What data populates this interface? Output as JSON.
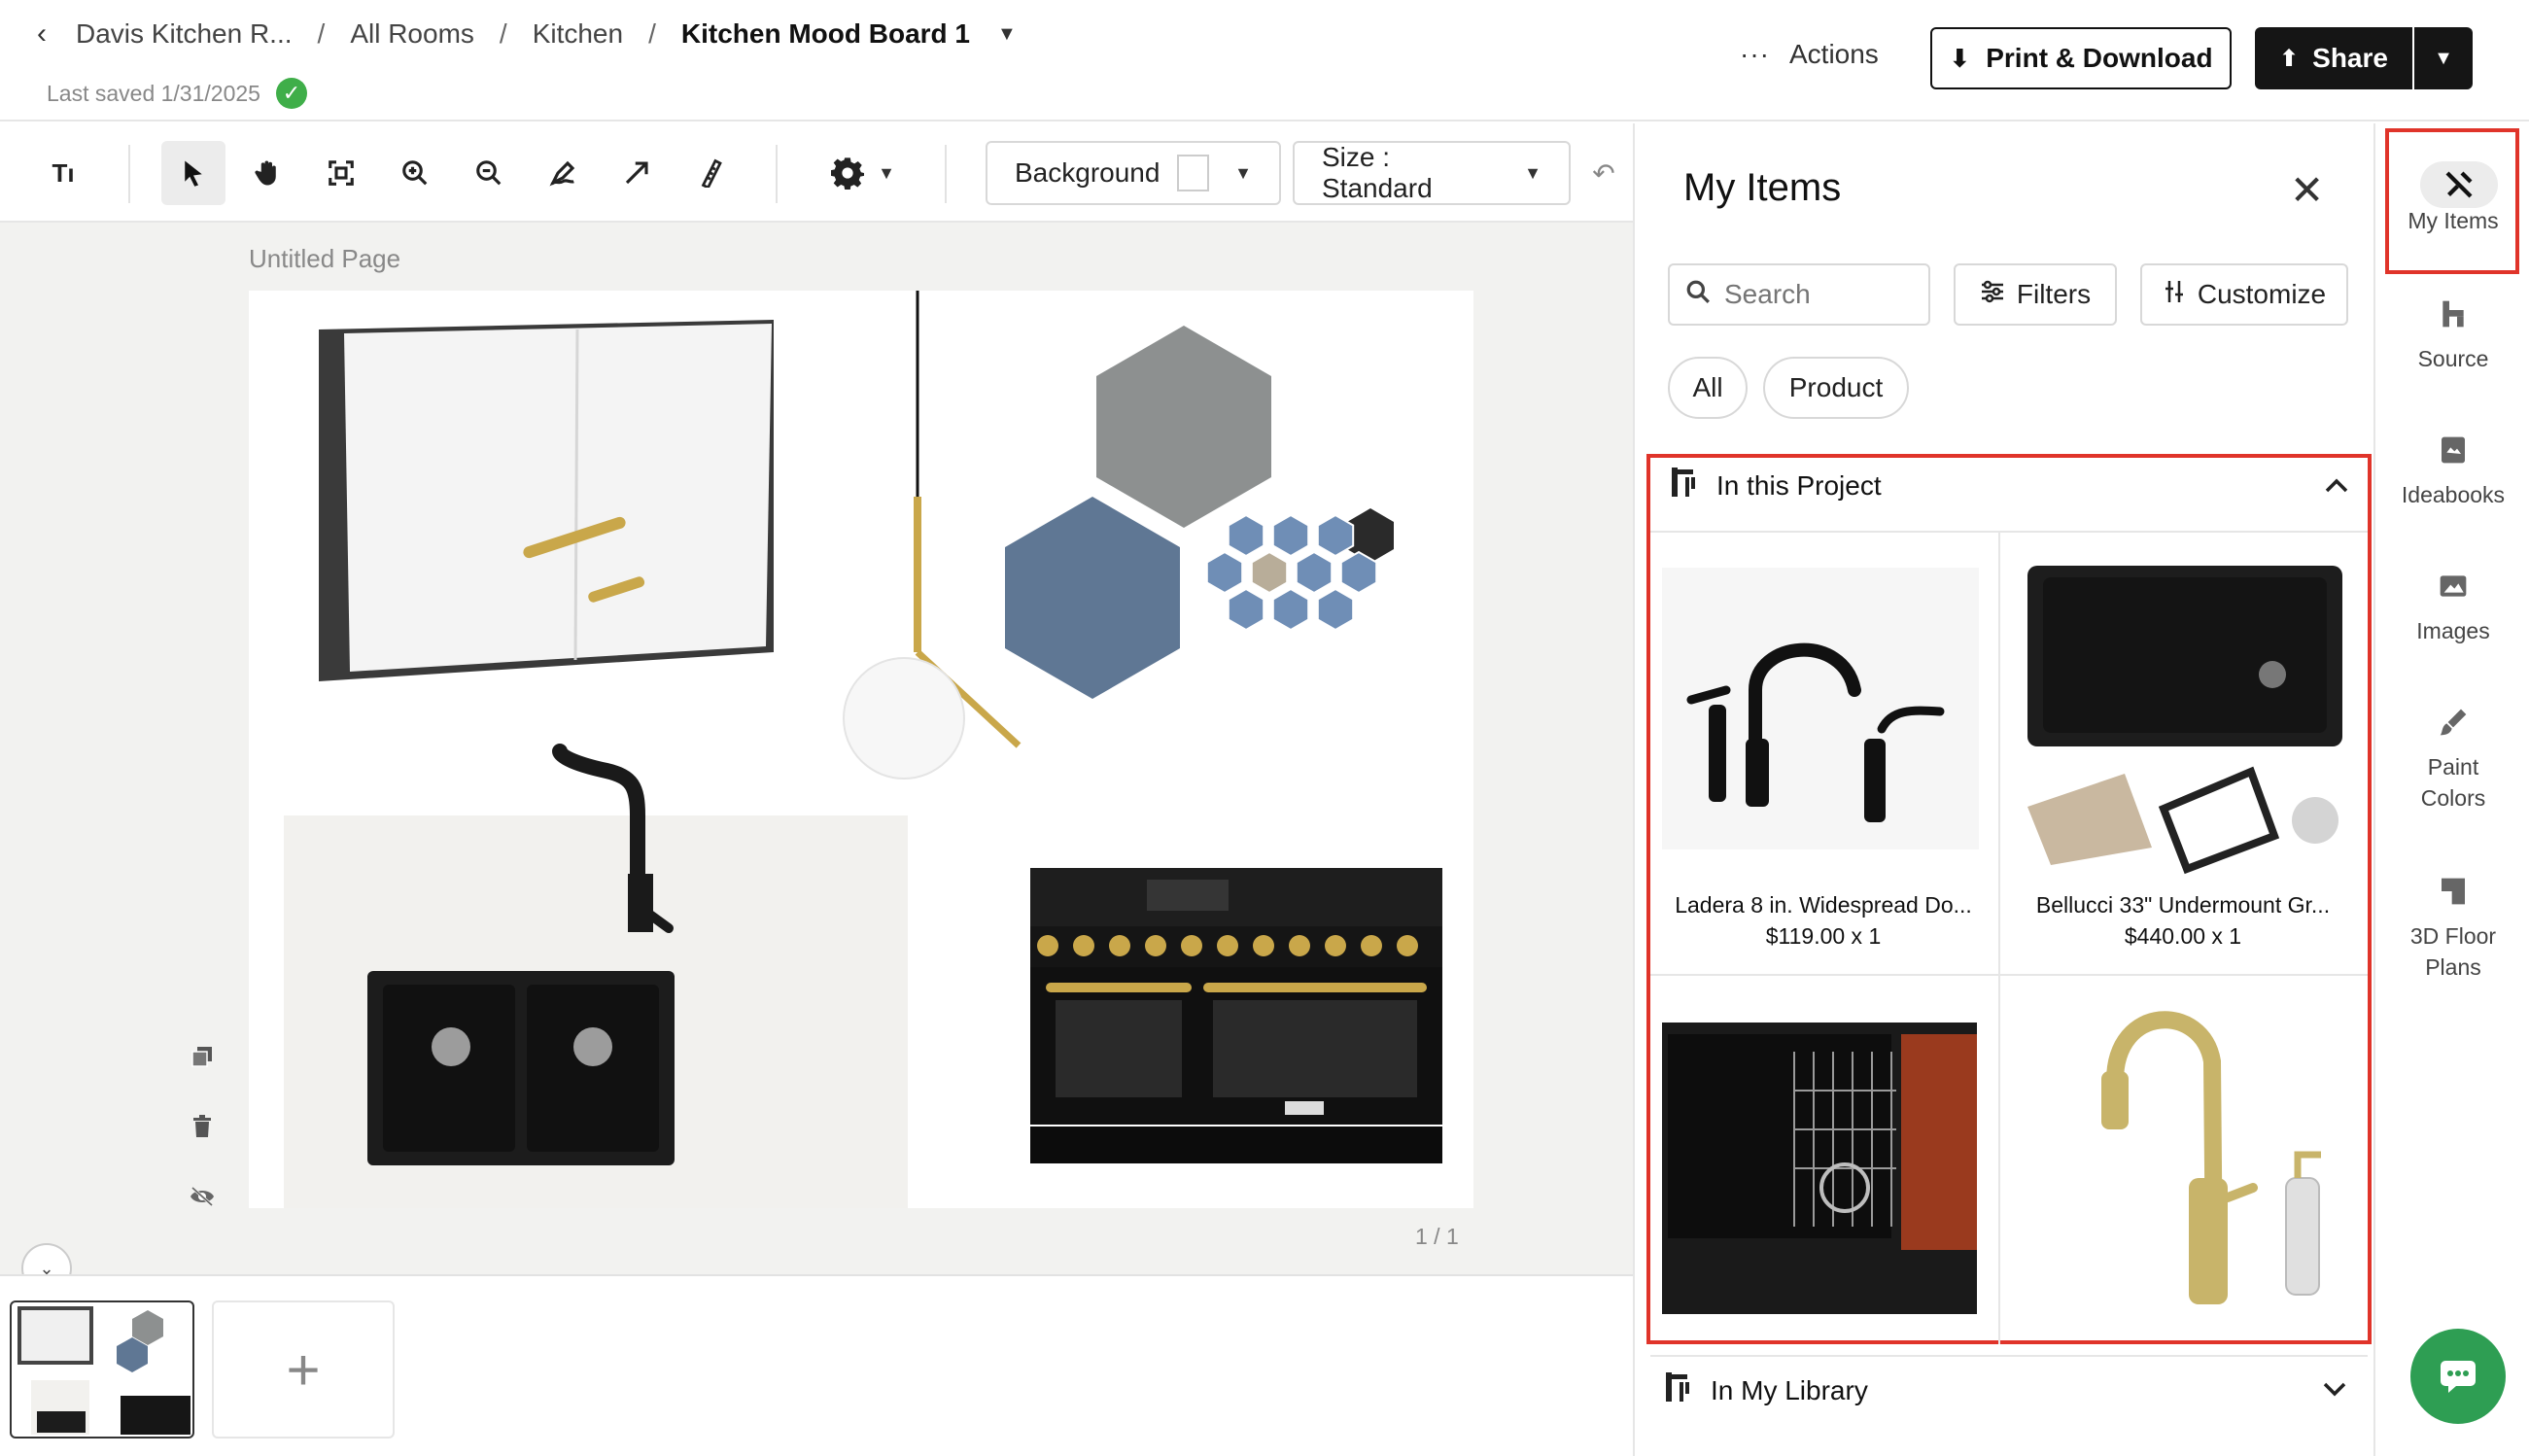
{
  "header": {
    "breadcrumbs": [
      "Davis Kitchen R...",
      "All Rooms",
      "Kitchen"
    ],
    "current_board": "Kitchen Mood Board 1",
    "separator": "/",
    "last_saved": "Last saved 1/31/2025",
    "actions_label": "Actions",
    "print_label": "Print & Download",
    "share_label": "Share"
  },
  "toolbar": {
    "background_label": "Background",
    "size_label": "Size : Standard"
  },
  "canvas": {
    "page_title": "Untitled Page",
    "page_counter": "1 / 1"
  },
  "panel": {
    "title": "My Items",
    "search_placeholder": "Search",
    "filters_label": "Filters",
    "customize_label": "Customize",
    "chips": [
      "All",
      "Product"
    ],
    "project_section": "In this Project",
    "library_section": "In My Library",
    "items": [
      {
        "name": "Ladera 8 in. Widespread Do...",
        "price": "$119.00 x 1"
      },
      {
        "name": "Bellucci 33\" Undermount Gr...",
        "price": "$440.00 x 1"
      }
    ]
  },
  "rail": {
    "items": [
      "My Items",
      "Source",
      "Ideabooks",
      "Images",
      "Paint Colors",
      "3D Floor Plans"
    ]
  },
  "colors": {
    "accent_dark": "#151515",
    "highlight_red": "#e0342a",
    "success_green": "#3fae49",
    "chat_green": "#2e9e53"
  }
}
